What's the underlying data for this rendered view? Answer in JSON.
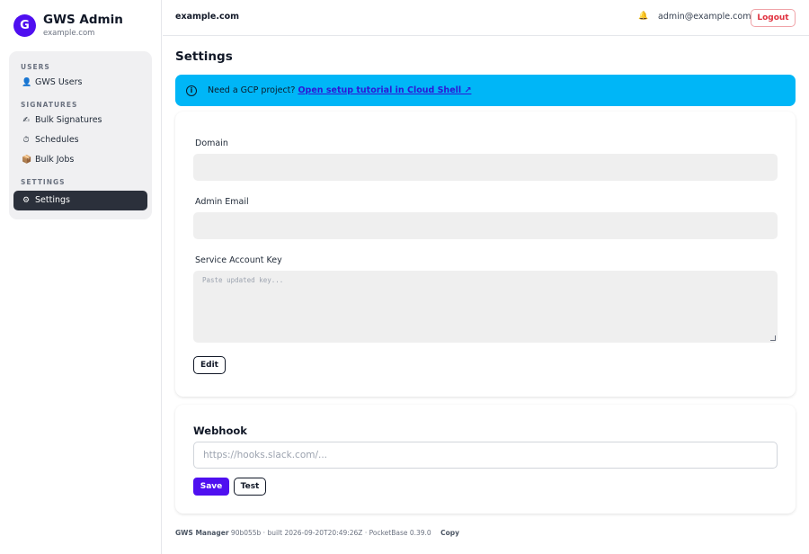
{
  "brand": {
    "initial": "G",
    "title": "GWS Admin",
    "subtitle": "example.com",
    "color": "#4f0ff0"
  },
  "nav": {
    "sections": [
      {
        "label": "USERS",
        "items": [
          {
            "icon": "👤",
            "icon_name": "user-icon",
            "label": "GWS Users"
          }
        ]
      },
      {
        "label": "SIGNATURES",
        "items": [
          {
            "icon": "✍",
            "icon_name": "signature-icon",
            "label": "Bulk Signatures"
          },
          {
            "icon": "⏱",
            "icon_name": "clock-icon",
            "label": "Schedules"
          },
          {
            "icon": "📦",
            "icon_name": "jobs-icon",
            "label": "Bulk Jobs"
          }
        ]
      },
      {
        "label": "SETTINGS",
        "items": [
          {
            "icon": "⚙",
            "icon_name": "gear-icon",
            "label": "Settings",
            "active": true
          }
        ]
      }
    ]
  },
  "header": {
    "domain": "example.com",
    "bell_icon": "🔔",
    "user_email": "admin@example.com",
    "logout_label": "Logout"
  },
  "page": {
    "title": "Settings"
  },
  "banner": {
    "icon": "i",
    "text": "Need a GCP project?",
    "link_label": "Open setup tutorial in Cloud Shell ↗",
    "color": "#00b6f7"
  },
  "form": {
    "domain_label": "Domain",
    "domain_value": "",
    "admin_email_label": "Admin Email",
    "admin_email_value": "",
    "service_key_label": "Service Account Key",
    "service_key_placeholder": "Paste updated key...",
    "edit_label": "Edit"
  },
  "webhook": {
    "title": "Webhook",
    "placeholder": "https://hooks.slack.com/...",
    "save_label": "Save",
    "test_label": "Test"
  },
  "footer": {
    "app_name": "GWS Manager",
    "build_info": "90b055b · built 2026-09-20T20:49:26Z · PocketBase 0.39.0",
    "copy_label": "Copy"
  }
}
